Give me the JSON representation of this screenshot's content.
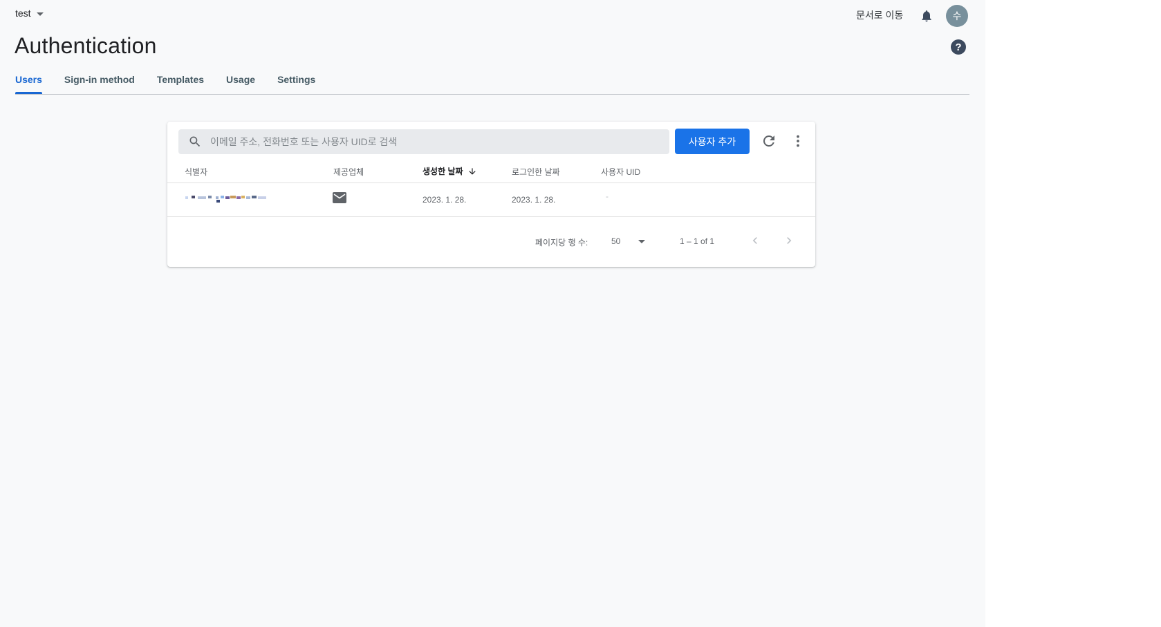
{
  "header": {
    "project": "test",
    "docs_link": "문서로 이동",
    "avatar_letter": "수",
    "title": "Authentication",
    "icons": [
      "chevron-down-icon",
      "bell-icon",
      "help-icon"
    ]
  },
  "tabs": [
    {
      "label": "Users",
      "active": true
    },
    {
      "label": "Sign-in method",
      "active": false
    },
    {
      "label": "Templates",
      "active": false
    },
    {
      "label": "Usage",
      "active": false
    },
    {
      "label": "Settings",
      "active": false
    }
  ],
  "toolbar": {
    "search_placeholder": "이메일 주소, 전화번호 또는 사용자 UID로 검색",
    "add_user_label": "사용자 추가",
    "icons": [
      "search-icon",
      "refresh-icon",
      "more-vert-icon"
    ]
  },
  "table": {
    "columns": [
      "식별자",
      "제공업체",
      "생성한 날짜",
      "로그인한 날짜",
      "사용자 UID"
    ],
    "sorted_column": "생성한 날짜",
    "sort_direction": "descending",
    "rows": [
      {
        "identifier": "(redacted)",
        "provider_icon": "mail-icon",
        "created": "2023. 1. 28.",
        "signed_in": "2023. 1. 28.",
        "uid": "-"
      }
    ]
  },
  "pagination": {
    "rows_per_page_label": "페이지당 행 수:",
    "rows_per_page": "50",
    "range": "1 – 1 of 1"
  },
  "colors": {
    "accent": "#1a73e8",
    "active_tab": "#1967d2",
    "background": "#f8f9fa",
    "avatar": "#78909c"
  }
}
